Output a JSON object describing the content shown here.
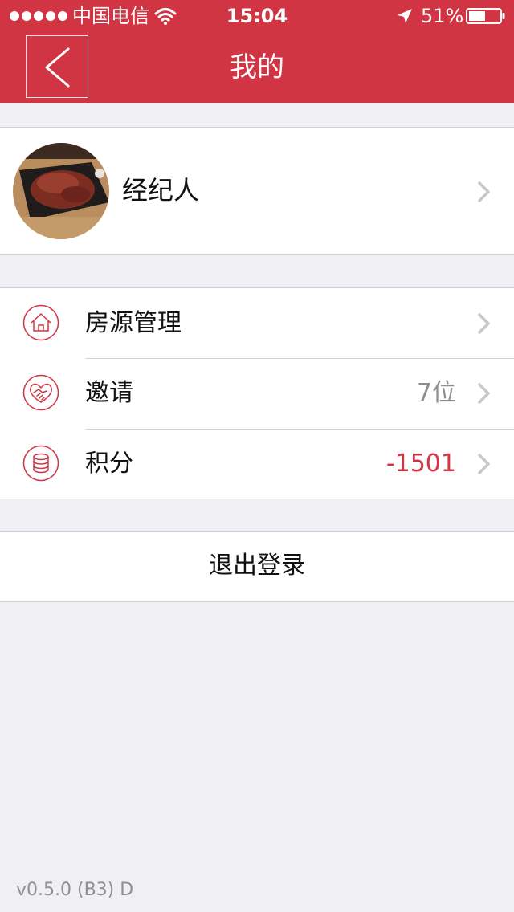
{
  "status_bar": {
    "carrier": "中国电信",
    "time": "15:04",
    "battery": "51%"
  },
  "header": {
    "title": "我的",
    "background_color": "#d13543"
  },
  "profile": {
    "name": "经纪人"
  },
  "menu": {
    "items": [
      {
        "label": "房源管理",
        "value": "",
        "icon": "house-icon"
      },
      {
        "label": "邀请",
        "value": "7位",
        "icon": "handshake-icon"
      },
      {
        "label": "积分",
        "value": "-1501",
        "icon": "coins-icon",
        "value_color": "#d13543"
      }
    ]
  },
  "logout": {
    "label": "退出登录"
  },
  "footer": {
    "version": "v0.5.0 (B3) D"
  }
}
